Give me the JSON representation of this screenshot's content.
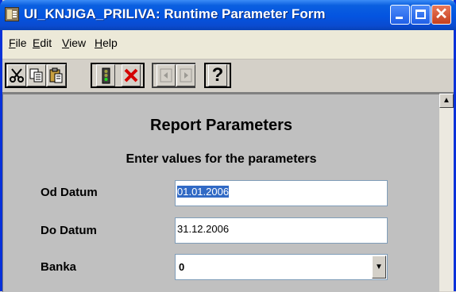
{
  "window": {
    "title": "UI_KNJIGA_PRILIVA: Runtime Parameter Form"
  },
  "menu": {
    "items": [
      "File",
      "Edit",
      "View",
      "Help"
    ]
  },
  "toolbar": {
    "cut_icon": "scissors-icon",
    "copy_icon": "copy-icon",
    "paste_icon": "paste-icon",
    "run_icon": "traffic-light-icon",
    "cancel_icon": "red-x-icon",
    "prev_icon": "previous-page-icon",
    "next_icon": "next-page-icon",
    "help_icon": "question-mark-icon",
    "help_glyph": "?"
  },
  "form": {
    "heading": "Report Parameters",
    "subheading": "Enter values for the parameters",
    "fields": [
      {
        "label": "Od Datum",
        "value": "01.01.2006"
      },
      {
        "label": "Do Datum",
        "value": "31.12.2006"
      }
    ],
    "banka": {
      "label": "Banka",
      "value": "0"
    }
  },
  "colors": {
    "titlebar": "#0454e0",
    "selection": "#316ac5",
    "cancel": "#d40000"
  }
}
